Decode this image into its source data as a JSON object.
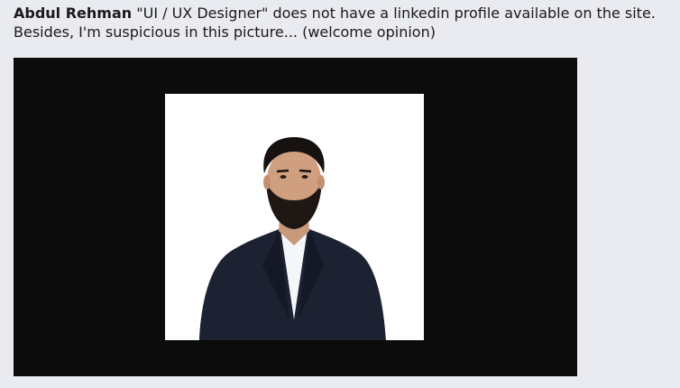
{
  "post": {
    "author_name": "Abdul Rehman",
    "line1_text": " \"UI / UX Designer\" does not have a linkedin profile available on the site.",
    "line2_text": "Besides, I'm suspicious in this picture... (welcome opinion)"
  },
  "photo": {
    "subject": "profile-photo-man-in-suit",
    "background_color": "#ffffff",
    "frame_color": "#0c0c0c"
  }
}
